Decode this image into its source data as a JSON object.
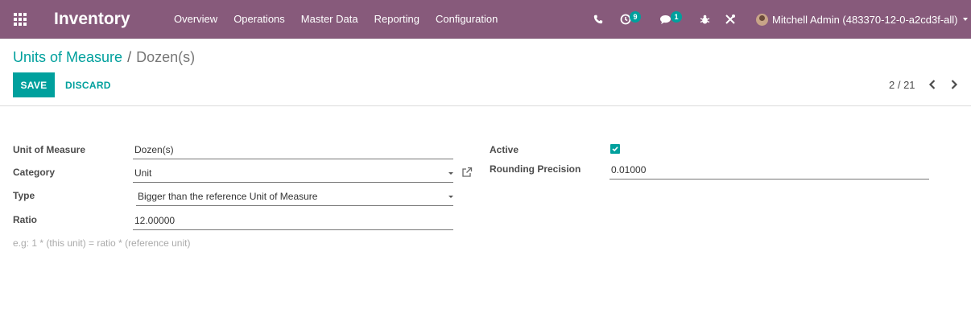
{
  "app": {
    "title": "Inventory"
  },
  "navbar": {
    "menu": [
      {
        "label": "Overview"
      },
      {
        "label": "Operations"
      },
      {
        "label": "Master Data"
      },
      {
        "label": "Reporting"
      },
      {
        "label": "Configuration"
      }
    ],
    "activities_badge": "9",
    "messages_badge": "1",
    "user_name": "Mitchell Admin (483370-12-0-a2cd3f-all)",
    "icons": [
      "apps-icon",
      "phone-icon",
      "clock-icon",
      "chat-icon",
      "bug-icon",
      "tools-icon",
      "avatar",
      "chevron-down-icon"
    ],
    "color": "#875a7b"
  },
  "breadcrumb": {
    "parent": "Units of Measure",
    "separator": "/",
    "current": "Dozen(s)"
  },
  "buttons": {
    "save": "SAVE",
    "discard": "DISCARD"
  },
  "pager": {
    "value": "2 / 21"
  },
  "form": {
    "uom_label": "Unit of Measure",
    "uom_value": "Dozen(s)",
    "category_label": "Category",
    "category_value": "Unit",
    "type_label": "Type",
    "type_value": "Bigger than the reference Unit of Measure",
    "ratio_label": "Ratio",
    "ratio_value": "12.00000",
    "ratio_help": "e.g: 1 * (this unit) = ratio * (reference unit)",
    "active_label": "Active",
    "active_checked": true,
    "rounding_label": "Rounding Precision",
    "rounding_value": "0.01000"
  },
  "accent_color": "#00a09d"
}
